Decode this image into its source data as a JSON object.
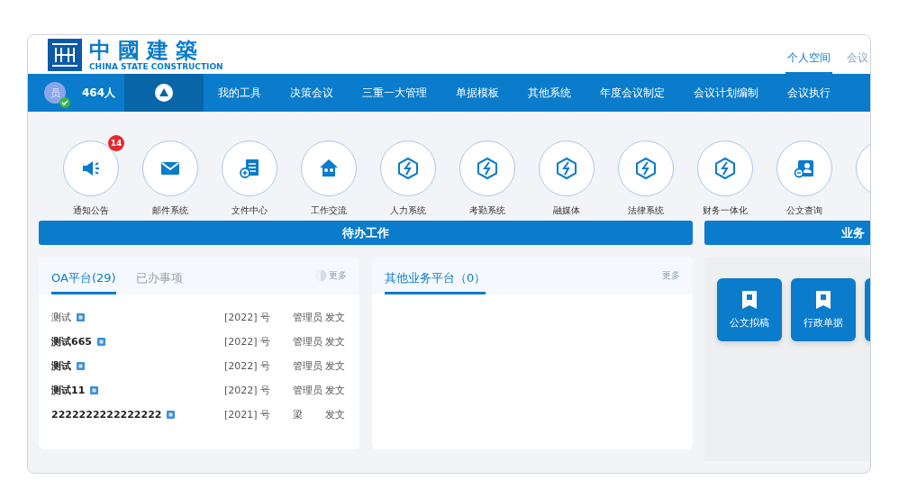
{
  "header": {
    "logo_cn": "中國建築",
    "logo_en": "CHINA STATE CONSTRUCTION",
    "tabs": [
      {
        "label": "个人空间",
        "selected": true
      },
      {
        "label": "会议",
        "selected": false
      }
    ]
  },
  "nav": {
    "avatar": "员",
    "count": "464人",
    "home_selected": true,
    "items": [
      {
        "label": "我的工具",
        "selected": false
      },
      {
        "label": "决策会议",
        "selected": false
      },
      {
        "label": "三重一大管理",
        "selected": false
      },
      {
        "label": "单据模板",
        "selected": false
      },
      {
        "label": "其他系统",
        "selected": false
      },
      {
        "label": "年度会议制定",
        "selected": false
      },
      {
        "label": "会议计划编制",
        "selected": false
      },
      {
        "label": "会议执行",
        "selected": false
      }
    ]
  },
  "apps": [
    {
      "label": "通知公告",
      "badge": "14"
    },
    {
      "label": "邮件系统"
    },
    {
      "label": "文件中心"
    },
    {
      "label": "工作交流"
    },
    {
      "label": "人力系统"
    },
    {
      "label": "考勤系统"
    },
    {
      "label": "融媒体"
    },
    {
      "label": "法律系统"
    },
    {
      "label": "财务一体化"
    },
    {
      "label": "公文查询"
    }
  ],
  "todo": {
    "title": "待办工作",
    "oa_panel": {
      "tabs": [
        {
          "label": "OA平台(29)",
          "selected": true
        },
        {
          "label": "已办事项",
          "selected": false
        }
      ],
      "more": "更多",
      "rows": [
        {
          "title": "测试",
          "unread": false,
          "number": "[2022] 号",
          "author": "管理员",
          "type": "发文"
        },
        {
          "title": "测试665",
          "unread": true,
          "number": "[2022] 号",
          "author": "管理员",
          "type": "发文"
        },
        {
          "title": "测试",
          "unread": true,
          "number": "[2022] 号",
          "author": "管理员",
          "type": "发文"
        },
        {
          "title": "测试11",
          "unread": true,
          "number": "[2022] 号",
          "author": "管理员",
          "type": "发文"
        },
        {
          "title": "2222222222222222",
          "unread": true,
          "number": "[2021] 号",
          "author": "梁",
          "type": "发文"
        }
      ]
    },
    "other_panel": {
      "tabs": [
        {
          "label": "其他业务平台（0）",
          "selected": true
        }
      ],
      "more": "更多"
    }
  },
  "business": {
    "title": "业务",
    "tiles": [
      {
        "label": "公文拟稿"
      },
      {
        "label": "行政单据"
      }
    ]
  }
}
